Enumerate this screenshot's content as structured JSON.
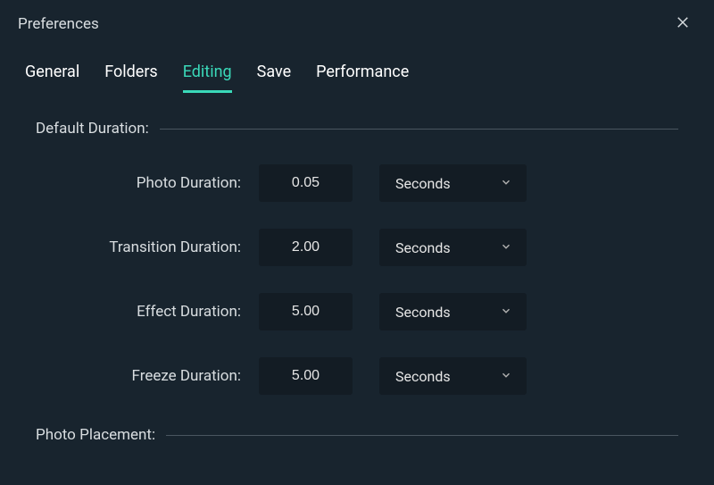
{
  "header": {
    "title": "Preferences"
  },
  "tabs": {
    "items": [
      {
        "label": "General"
      },
      {
        "label": "Folders"
      },
      {
        "label": "Editing"
      },
      {
        "label": "Save"
      },
      {
        "label": "Performance"
      }
    ],
    "active_index": 2
  },
  "sections": {
    "default_duration": {
      "label": "Default Duration:",
      "fields": {
        "photo": {
          "label": "Photo Duration:",
          "value": "0.05",
          "unit": "Seconds"
        },
        "transition": {
          "label": "Transition Duration:",
          "value": "2.00",
          "unit": "Seconds"
        },
        "effect": {
          "label": "Effect Duration:",
          "value": "5.00",
          "unit": "Seconds"
        },
        "freeze": {
          "label": "Freeze Duration:",
          "value": "5.00",
          "unit": "Seconds"
        }
      }
    },
    "photo_placement": {
      "label": "Photo Placement:"
    }
  }
}
